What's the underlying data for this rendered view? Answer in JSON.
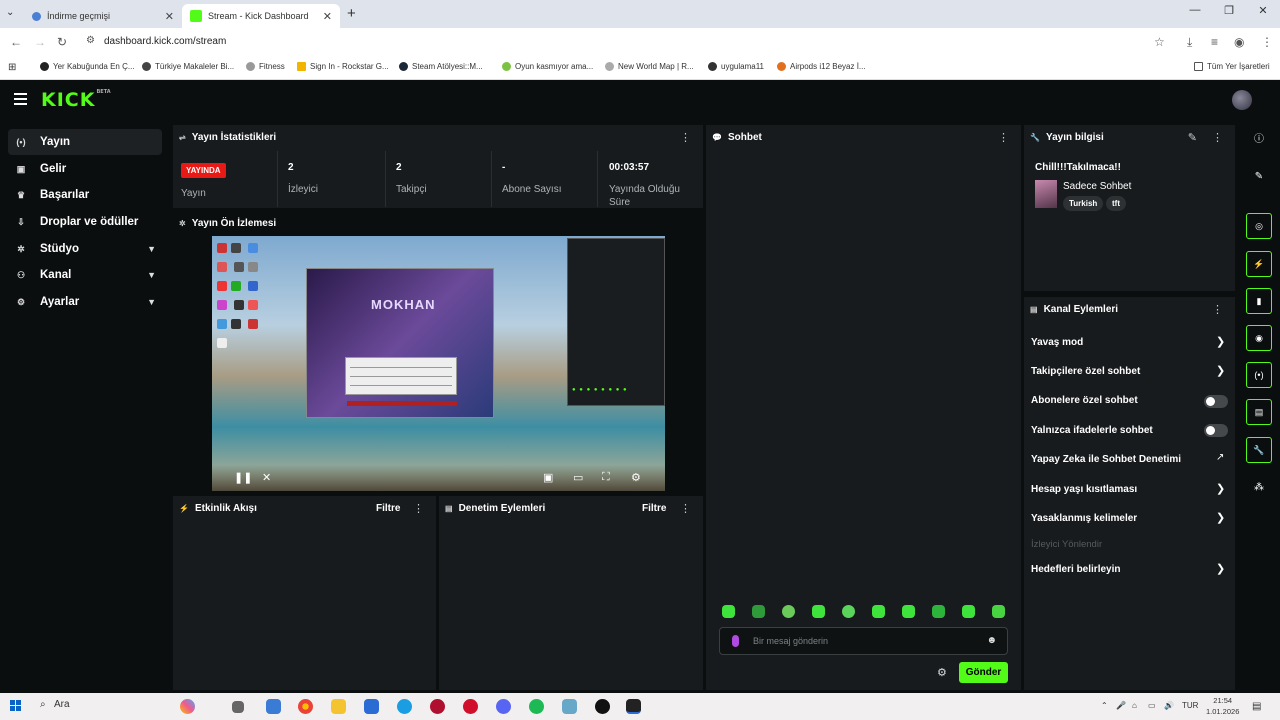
{
  "browser": {
    "tabs": [
      {
        "title": "İndirme geçmişi"
      },
      {
        "title": "Stream - Kick Dashboard"
      }
    ],
    "url": "dashboard.kick.com/stream",
    "bookmarks": [
      "Yer Kabuğunda En Ç...",
      "Türkiye Makaleler Bi...",
      "Fitness",
      "Sign In - Rockstar G...",
      "Steam Atölyesi::M...",
      "Oyun kasmıyor ama...",
      "New World Map | R...",
      "uygulama11",
      "Airpods i12 Beyaz İ...",
      "Tüm Yer İşaretleri"
    ]
  },
  "header": {
    "logo": "KICK",
    "logo_badge": "BETA"
  },
  "sidebar": {
    "items": [
      {
        "label": "Yayın",
        "icon": "broadcast-icon"
      },
      {
        "label": "Gelir",
        "icon": "money-icon"
      },
      {
        "label": "Başarılar",
        "icon": "trophy-icon"
      },
      {
        "label": "Droplar ve ödüller",
        "icon": "drops-icon"
      },
      {
        "label": "Stüdyo",
        "icon": "studio-icon"
      },
      {
        "label": "Kanal",
        "icon": "channel-icon"
      },
      {
        "label": "Ayarlar",
        "icon": "gear-icon"
      }
    ]
  },
  "stats": {
    "title": "Yayın İstatistikleri",
    "live_badge": "YAYINDA",
    "live_label": "Yayın",
    "viewers_value": "2",
    "viewers_label": "İzleyici",
    "followers_value": "2",
    "followers_label": "Takipçi",
    "subs_value": "-",
    "subs_label": "Abone Sayısı",
    "uptime_value": "00:03:57",
    "uptime_label": "Yayında Olduğu Süre"
  },
  "preview": {
    "title": "Yayın Ön İzlemesi",
    "game_logo": "MOKHAN"
  },
  "activity": {
    "title": "Etkinlik Akışı",
    "filter": "Filtre"
  },
  "moderation": {
    "title": "Denetim Eylemleri",
    "filter": "Filtre"
  },
  "chat": {
    "title": "Sohbet",
    "placeholder": "Bir mesaj gönderin",
    "send": "Gönder"
  },
  "stream_info": {
    "title": "Yayın bilgisi",
    "stream_title": "Chill!!!Takılmaca!!",
    "category": "Sadece Sohbet",
    "tags": [
      "Turkish",
      "tft"
    ]
  },
  "channel_actions": {
    "title": "Kanal Eylemleri",
    "items": [
      {
        "label": "Yavaş mod"
      },
      {
        "label": "Takipçilere özel sohbet"
      },
      {
        "label": "Abonelere özel sohbet"
      },
      {
        "label": "Yalnızca ifadelerle sohbet"
      },
      {
        "label": "Yapay Zeka ile Sohbet Denetimi"
      },
      {
        "label": "Hesap yaşı kısıtlaması"
      },
      {
        "label": "Yasaklanmış kelimeler"
      },
      {
        "label": "İzleyici Yönlendir"
      },
      {
        "label": "Hedefleri belirleyin"
      }
    ]
  },
  "taskbar": {
    "search": "Ara",
    "lang": "TUR",
    "time": "21:54",
    "date": "1.01.2026"
  },
  "colors": {
    "accent": "#53fc18",
    "live": "#e91916",
    "panel": "#181b1d"
  }
}
